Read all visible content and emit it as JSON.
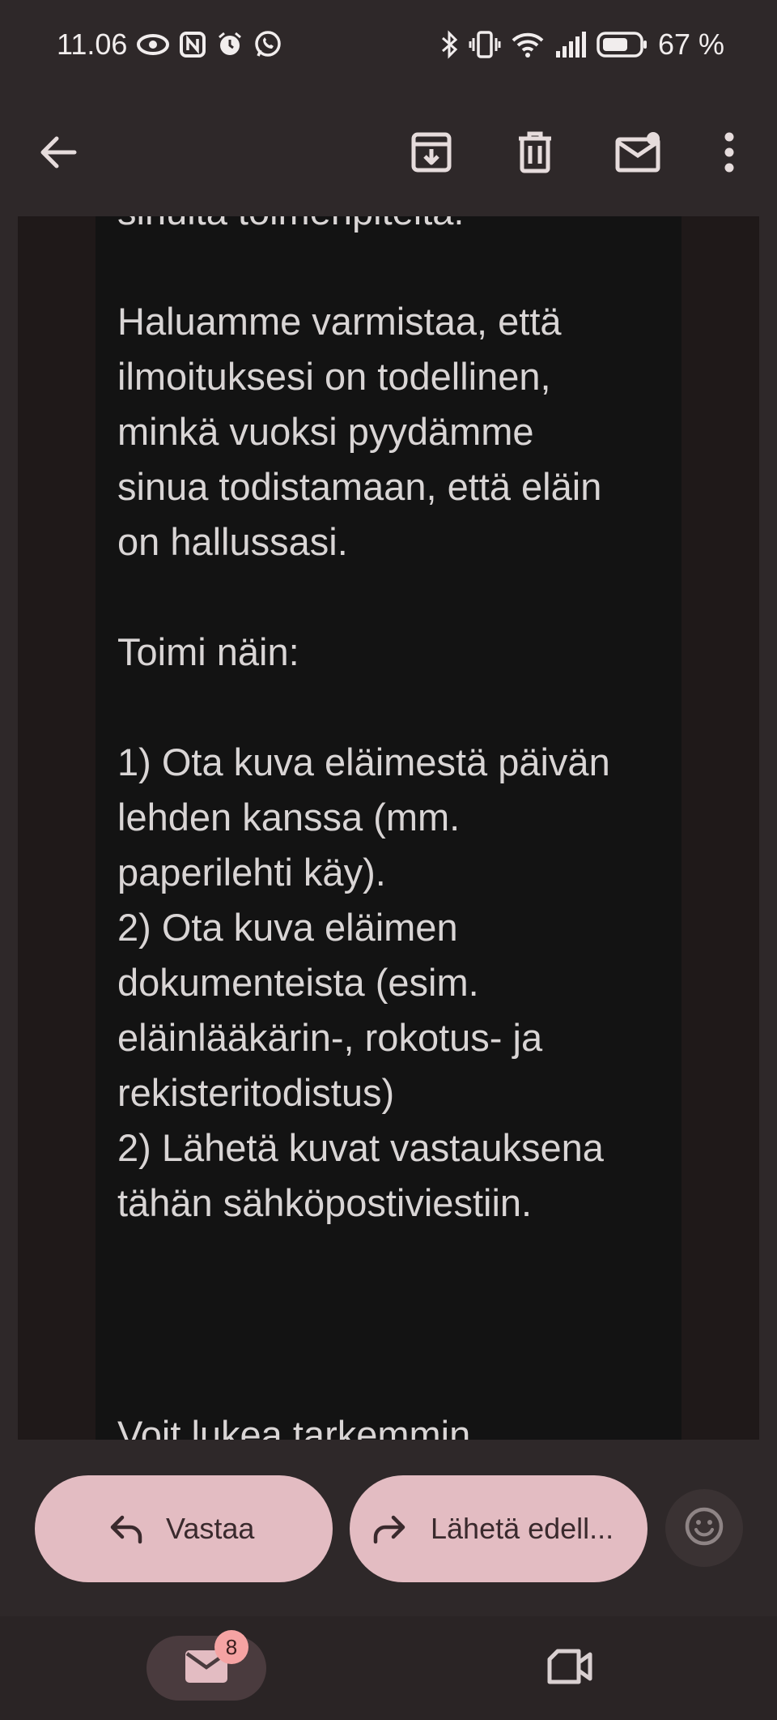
{
  "status_bar": {
    "time": "11.06",
    "battery": "67 %",
    "left_icons": [
      "eye-icon",
      "nfc-icon",
      "alarm-icon",
      "whatsapp-icon"
    ],
    "right_icons": [
      "bluetooth-icon",
      "vibrate-icon",
      "wifi-icon",
      "signal-icon",
      "battery-icon"
    ]
  },
  "toolbar": {
    "back_icon": "arrow-back-icon",
    "archive_icon": "archive-icon",
    "delete_icon": "trash-icon",
    "mark_unread_icon": "mail-unread-icon",
    "more_icon": "more-vert-icon"
  },
  "email": {
    "lines": [
      "sinulta toimenpiteitä.",
      "",
      "Haluamme varmistaa, että",
      "ilmoituksesi on todellinen,",
      "minkä vuoksi pyydämme",
      "sinua todistamaan, että eläin",
      "on hallussasi.",
      "",
      "Toimi näin:",
      "",
      "1) Ota kuva eläimestä päivän",
      "lehden kanssa (mm.",
      "paperilehti käy).",
      "2) Ota kuva eläimen",
      "dokumenteista (esim.",
      "eläinlääkärin-, rokotus- ja",
      "rekisteritodistus)",
      "2) Lähetä kuvat vastauksena",
      "tähän sähköpostiviestiin."
    ],
    "footer_partial": "Voit lukea tarkemmin"
  },
  "actions": {
    "reply_label": "Vastaa",
    "forward_label": "Lähetä edell...",
    "emoji_icon": "emoji-icon"
  },
  "bottom_nav": {
    "mail_badge": "8",
    "mail_icon": "mail-icon",
    "meet_icon": "video-icon"
  },
  "colors": {
    "background": "#2e2829",
    "email_card": "#131313",
    "pill": "#e3bcc2",
    "badge": "#f5a3a3"
  }
}
